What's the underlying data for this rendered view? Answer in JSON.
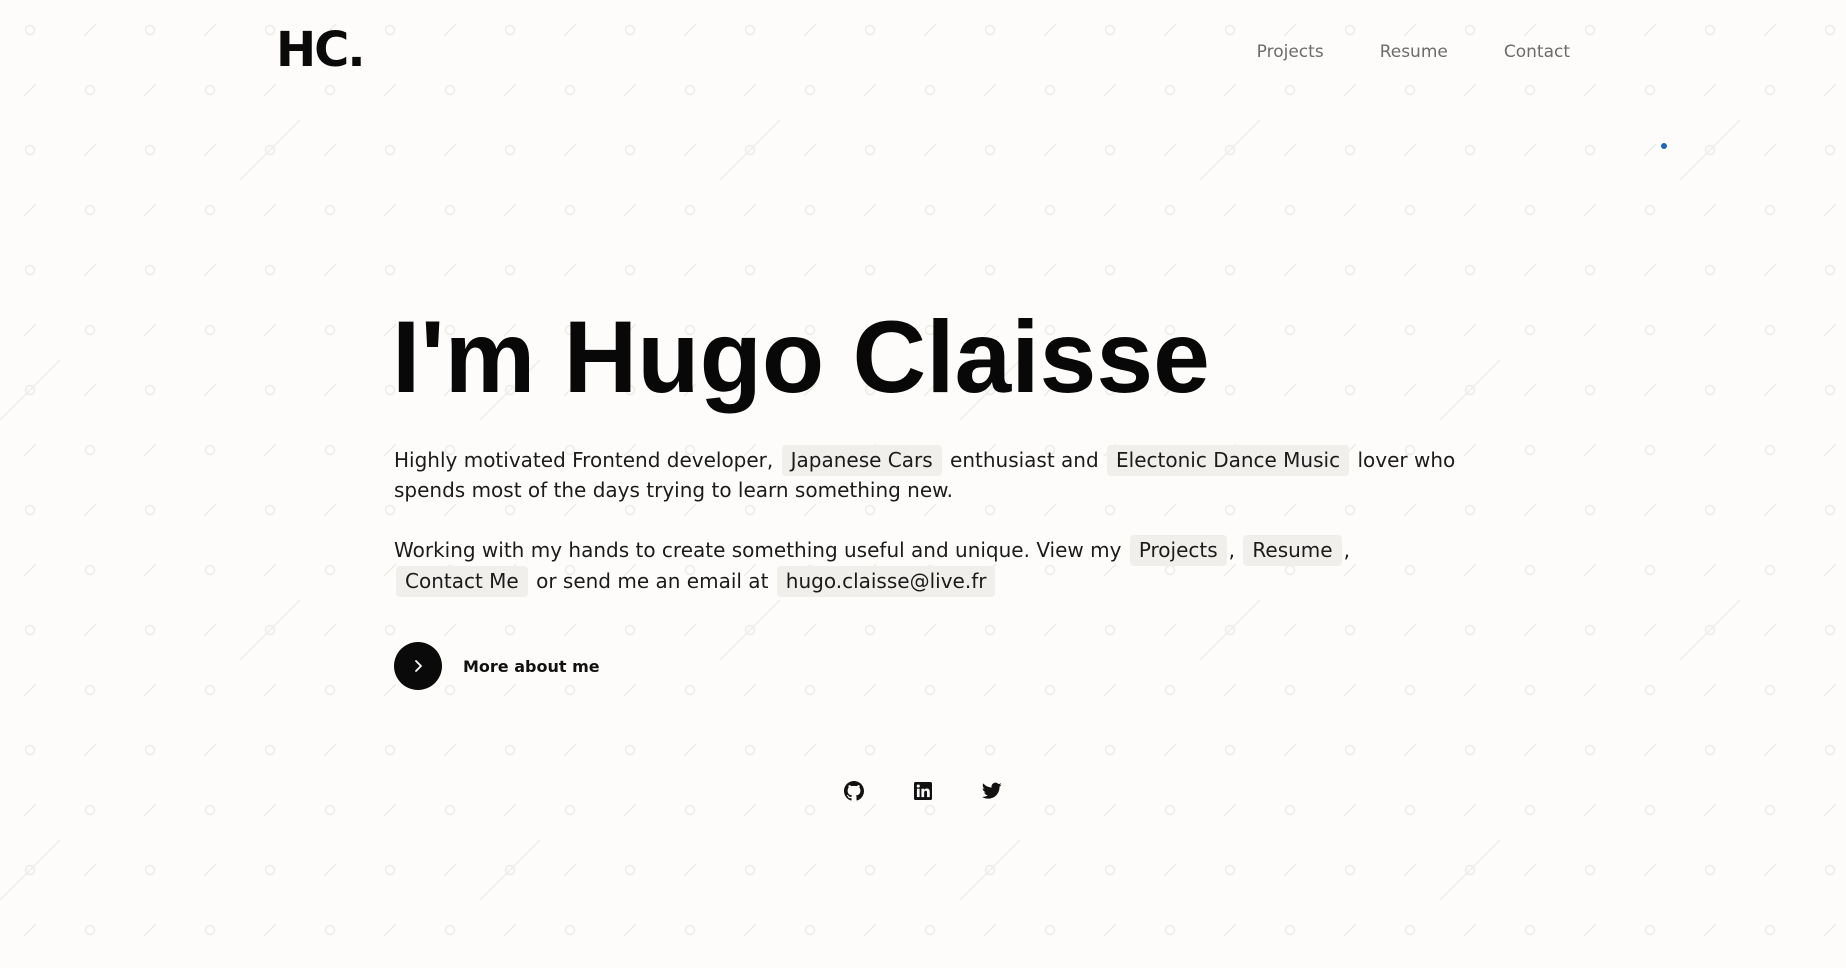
{
  "header": {
    "logo": "HC.",
    "nav": [
      {
        "label": "Projects"
      },
      {
        "label": "Resume"
      },
      {
        "label": "Contact"
      }
    ]
  },
  "hero": {
    "title": "I'm Hugo Claisse",
    "intro": {
      "text_1": "Highly motivated Frontend developer,",
      "chip_1": "Japanese Cars",
      "text_2": "enthusiast and",
      "chip_2": "Electonic Dance Music",
      "text_3": "lover who spends most of the days trying to learn something new."
    },
    "work": {
      "text_1": "Working with my hands to create something useful and unique. View my",
      "link_projects": "Projects",
      "comma_1": ",",
      "link_resume": "Resume",
      "comma_2": ",",
      "link_contact": "Contact Me",
      "text_2": "or send me an email at",
      "email": "hugo.claisse@live.fr"
    },
    "more_button": {
      "label": "More about me",
      "icon": "chevron-right-icon"
    }
  },
  "socials": [
    {
      "icon": "github-icon"
    },
    {
      "icon": "linkedin-icon"
    },
    {
      "icon": "twitter-icon"
    }
  ],
  "colors": {
    "background": "#fdfcfa",
    "text": "#111111",
    "nav_text": "#6b6b6b",
    "chip_bg": "#f0efec",
    "accent_dot": "#1c64c8"
  }
}
